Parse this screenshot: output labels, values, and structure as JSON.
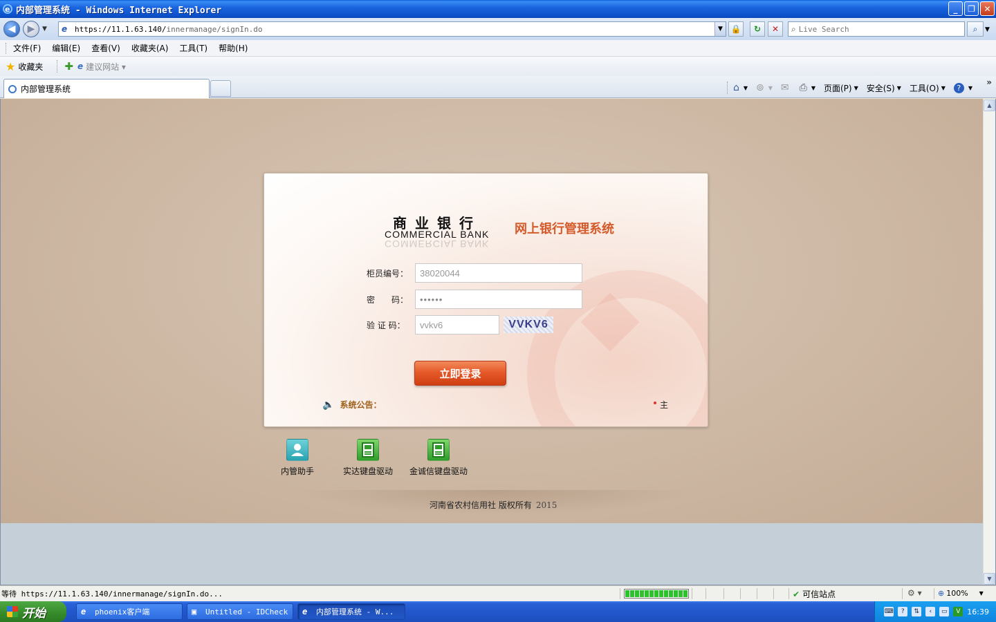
{
  "window": {
    "title": "内部管理系统 - Windows Internet Explorer"
  },
  "address_bar": {
    "url_host": "https://11.1.63.140/",
    "url_path": "innermanage/signIn.do"
  },
  "search": {
    "placeholder": "Live Search"
  },
  "menu": {
    "items": [
      "文件(F)",
      "编辑(E)",
      "查看(V)",
      "收藏夹(A)",
      "工具(T)",
      "帮助(H)"
    ]
  },
  "favorites_bar": {
    "favorites_label": "收藏夹",
    "suggested_sites_label": "建议网站"
  },
  "tabs": {
    "active_tab_label": "内部管理系统"
  },
  "command_bar": {
    "page_label": "页面(P)",
    "safety_label": "安全(S)",
    "tools_label": "工具(O)"
  },
  "login": {
    "bank_name_cn": "商业银行",
    "bank_name_en": "COMMERCIAL BANK",
    "system_title": "网上银行管理系统",
    "teller_label": "柜员编号：",
    "teller_value": "38020044",
    "password_label": "密　　码：",
    "password_value": "••••••",
    "captcha_label": "验 证 码：",
    "captcha_value": "vvkv6",
    "captcha_image_text": "VVKV6",
    "login_button": "立即登录",
    "notice_label": "系统公告：",
    "notice_tail": "主"
  },
  "downloads": [
    {
      "label": "内管助手",
      "icon": "user-icon"
    },
    {
      "label": "实达键盘驱动",
      "icon": "floppy-icon"
    },
    {
      "label": "金诚信键盘驱动",
      "icon": "floppy-icon"
    }
  ],
  "footer": {
    "copyright": "河南省农村信用社 版权所有",
    "year": "2015"
  },
  "status_bar": {
    "status_text": "等待 https://11.1.63.140/innermanage/signIn.do...",
    "progress_fraction": 1.0,
    "zone_label": "可信站点",
    "zoom_label": "100%"
  },
  "taskbar": {
    "start_label": "开始",
    "items": [
      {
        "label": "phoenix客户端"
      },
      {
        "label": "Untitled - IDCheck"
      },
      {
        "label": "内部管理系统 - W..."
      }
    ],
    "clock": "16:39"
  },
  "colors": {
    "accent_orange": "#e65a2a",
    "title_orange": "#d45a2a",
    "xp_blue": "#1b66e0"
  }
}
